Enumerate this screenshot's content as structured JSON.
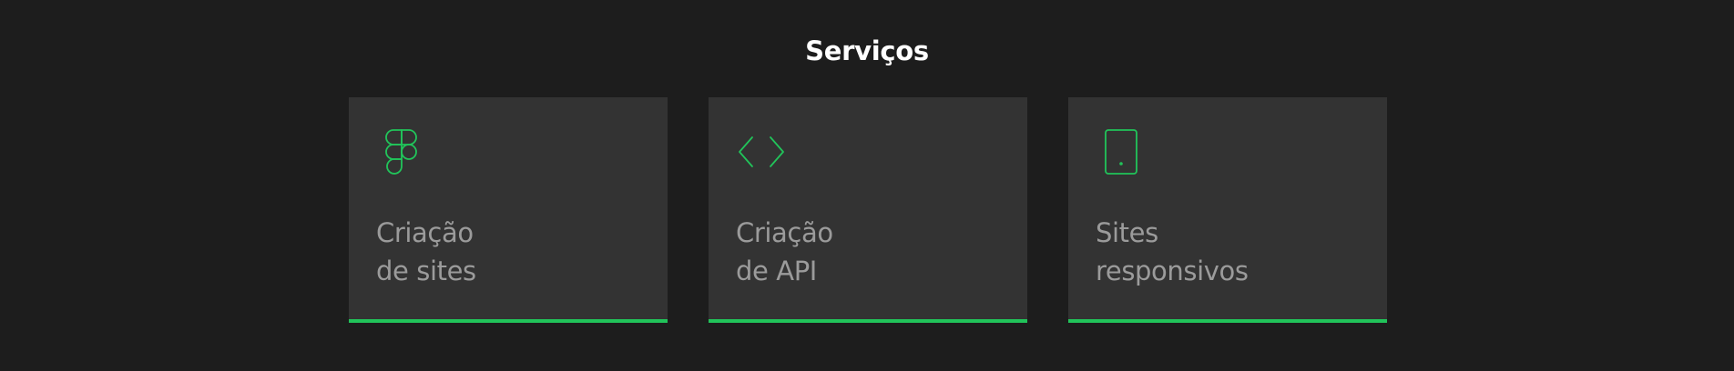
{
  "section": {
    "title": "Serviços"
  },
  "accent_color": "#21c45a",
  "cards": [
    {
      "icon": "figma-icon",
      "line1": "Criação",
      "line2": "de sites"
    },
    {
      "icon": "code-icon",
      "line1": "Criação",
      "line2": "de API"
    },
    {
      "icon": "smartphone-icon",
      "line1": "Sites",
      "line2": "responsivos"
    }
  ]
}
